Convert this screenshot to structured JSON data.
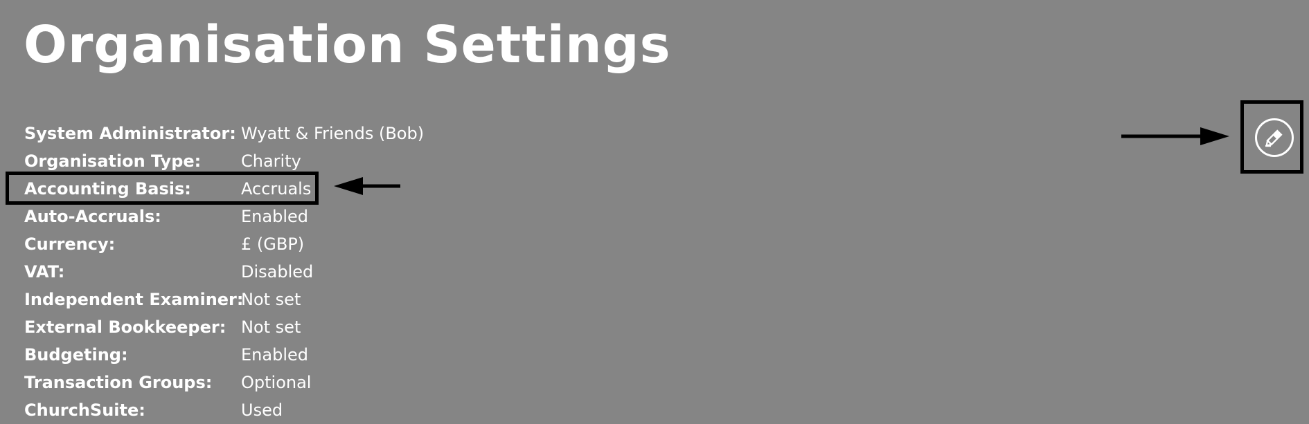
{
  "page": {
    "title": "Organisation Settings"
  },
  "settings": [
    {
      "label": "System Administrator:",
      "value": "Wyatt & Friends (Bob)"
    },
    {
      "label": "Organisation Type:",
      "value": "Charity"
    },
    {
      "label": "Accounting Basis:",
      "value": "Accruals"
    },
    {
      "label": "Auto-Accruals:",
      "value": "Enabled"
    },
    {
      "label": "Currency:",
      "value": "£ (GBP)"
    },
    {
      "label": "VAT:",
      "value": "Disabled"
    },
    {
      "label": "Independent Examiner:",
      "value": "Not set"
    },
    {
      "label": "External Bookkeeper:",
      "value": "Not set"
    },
    {
      "label": "Budgeting:",
      "value": "Enabled"
    },
    {
      "label": "Transaction Groups:",
      "value": "Optional"
    },
    {
      "label": "ChurchSuite:",
      "value": "Used"
    }
  ],
  "icons": {
    "edit": "edit-pencil-icon",
    "arrow": "arrow-icon"
  },
  "colors": {
    "background": "#858585",
    "text": "#ffffff",
    "annotation": "#000000"
  }
}
